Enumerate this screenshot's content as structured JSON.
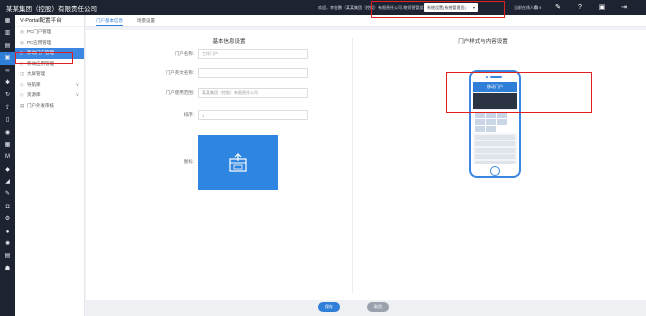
{
  "topbar": {
    "brand": "某某集团（控股）有限责任公司",
    "welcome": "欢迎，李金鹏（某某集团（控股）有限责任公司-物资营管部）首席",
    "system_select": "系统设置(系统管理员)",
    "online": "当前在线人数 9",
    "icons": [
      "home-icon",
      "wrench-icon",
      "help-icon",
      "window-icon",
      "logout-icon"
    ]
  },
  "rail": {
    "icons": [
      "app-icon",
      "chart-icon",
      "calendar-icon",
      "portal-icon",
      "link-icon",
      "settings-icon",
      "refresh-icon",
      "share-icon",
      "document-icon",
      "eye-icon",
      "grid-icon",
      "mail-icon",
      "chat-icon",
      "sync-icon",
      "edit-icon",
      "lock-icon",
      "gear-icon",
      "circle-icon",
      "star-icon",
      "printer-icon",
      "user-icon"
    ]
  },
  "menu": {
    "title": "V-Portal配置平台",
    "items": [
      {
        "label": "PC门户管理",
        "icon": "pc-icon"
      },
      {
        "label": "PC应用管理",
        "icon": "app-icon"
      },
      {
        "label": "移动门户管理",
        "icon": "mobile-icon",
        "active": true
      },
      {
        "label": "移动应用管理",
        "icon": "mobile-app-icon"
      },
      {
        "label": "大屏管理",
        "icon": "screen-icon"
      },
      {
        "label": "导航库",
        "icon": "nav-icon",
        "expandable": true
      },
      {
        "label": "资源库",
        "icon": "resource-icon",
        "expandable": true
      },
      {
        "label": "门户外发审核",
        "icon": "audit-icon"
      }
    ]
  },
  "tabs": [
    {
      "label": "门户基本信息",
      "active": true
    },
    {
      "label": "场景设置",
      "active": false
    }
  ],
  "form": {
    "section_title": "基本信息设置",
    "fields": [
      {
        "label": "门户名称:",
        "value": "工作门户"
      },
      {
        "label": "门户英文名称:",
        "value": ""
      },
      {
        "label": "门户使用范围:",
        "value": "某某集团（控股）有限责任公司"
      },
      {
        "label": "排序:",
        "value": "1"
      }
    ],
    "icon_label": "图标:"
  },
  "preview": {
    "section_title": "门户样式与内容设置",
    "phone_header": "移动门户"
  },
  "footer": {
    "save_label": "保存",
    "cancel_label": "取消"
  },
  "colors": {
    "accent": "#2f7fd8",
    "topbar_bg": "#1d2330",
    "highlight_border": "#e02020"
  }
}
